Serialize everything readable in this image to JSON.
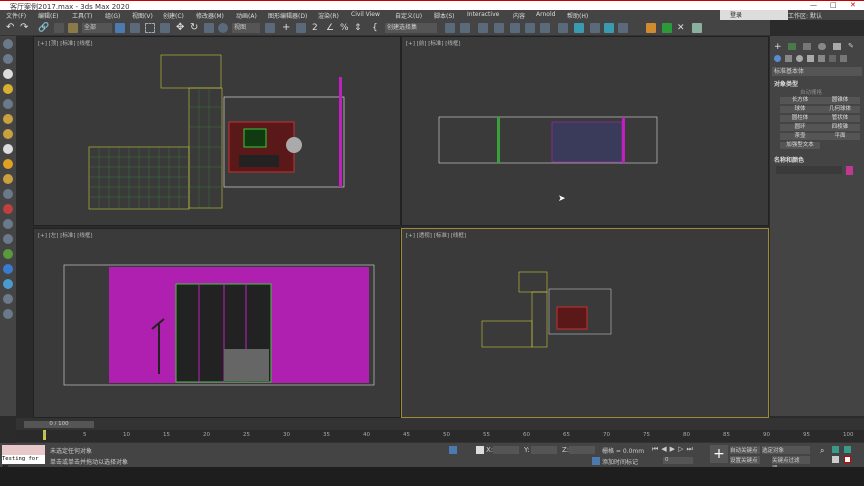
{
  "window": {
    "title": "客厅案例2017.max - 3ds Max 2020",
    "min": "—",
    "max": "□",
    "close": "✕"
  },
  "menu": [
    "文件(F)",
    "编辑(E)",
    "工具(T)",
    "组(G)",
    "视图(V)",
    "创建(C)",
    "修改器(M)",
    "动画(A)",
    "图形编辑器(D)",
    "渲染(R)",
    "Civil View",
    "自定义(U)",
    "脚本(S)",
    "Interactive",
    "内容",
    "Arnold",
    "帮助(H)"
  ],
  "login": "登录",
  "workspace_label": "工作区:",
  "workspace_value": "默认",
  "toolbar": {
    "filter": "全部",
    "view_ref": "视图",
    "selection_set": "创建选择集"
  },
  "viewports": [
    {
      "label": "[+] [顶] [标准] [线框]"
    },
    {
      "label": "[+] [前] [标准] [线框]"
    },
    {
      "label": "[+] [左] [标准] [线框]"
    },
    {
      "label": "[+] [透视] [标准] [线框]"
    }
  ],
  "command_panel": {
    "category": "标准基本体",
    "rollout_object_type": "对象类型",
    "autogrid": "自动栅格",
    "buttons": [
      "长方体",
      "圆锥体",
      "球体",
      "几何球体",
      "圆柱体",
      "管状体",
      "圆环",
      "四棱锥",
      "茶壶",
      "平面",
      "加强型文本"
    ],
    "rollout_name_color": "名称和颜色",
    "object_color": "#c0388f"
  },
  "timeline": {
    "frame": "0 / 100",
    "ticks": [
      "0",
      "5",
      "10",
      "15",
      "20",
      "25",
      "30",
      "35",
      "40",
      "45",
      "50",
      "55",
      "60",
      "65",
      "70",
      "75",
      "80",
      "85",
      "90",
      "95",
      "100"
    ]
  },
  "status": {
    "script_label": "Testing for AK",
    "line1": "未选定任何对象",
    "line2": "单击或单击并拖动以选择对象",
    "x_label": "X:",
    "y_label": "Y:",
    "z_label": "Z:",
    "grid": "栅格 = 0.0mm",
    "add_time_tag": "添加时间标记",
    "frame_value": "0",
    "auto_key": "自动关键点",
    "set_key": "设置关键点",
    "selected": "选定对象",
    "key_filters": "关键点过滤器..."
  }
}
